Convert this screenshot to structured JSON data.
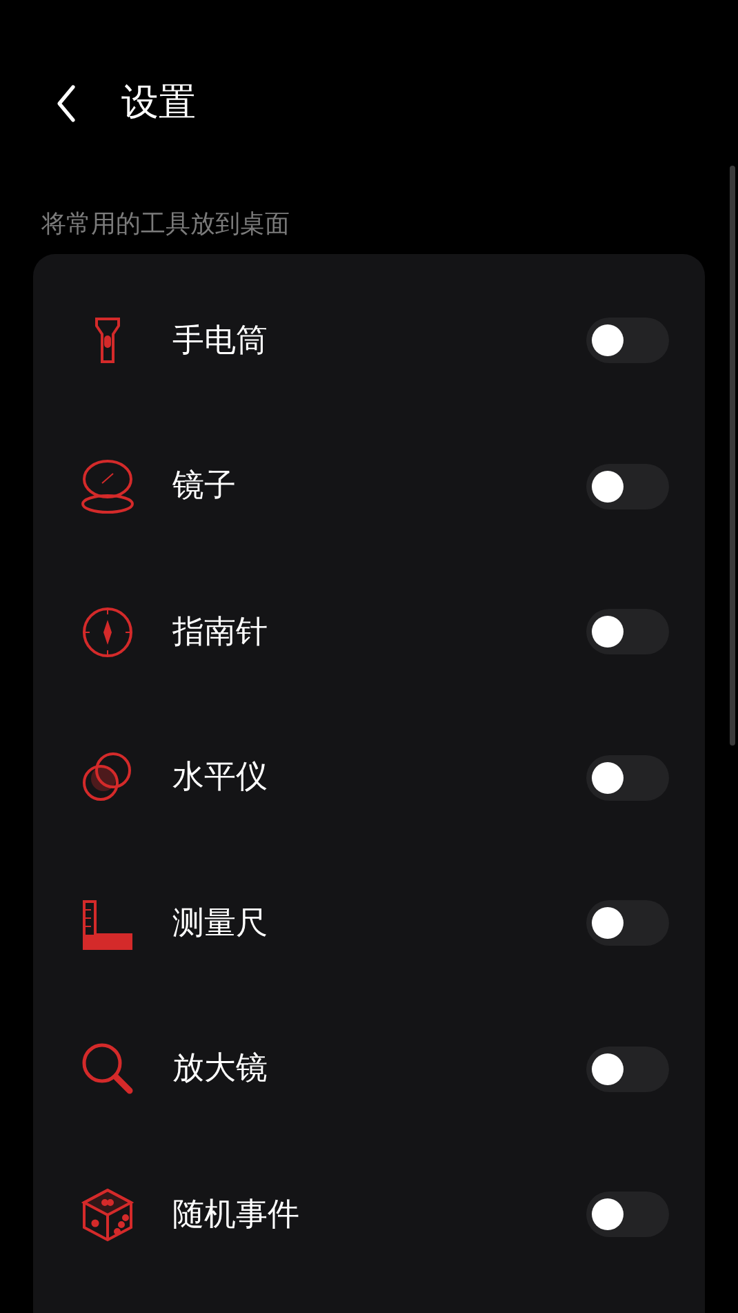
{
  "header": {
    "title": "设置"
  },
  "section": {
    "caption": "将常用的工具放到桌面"
  },
  "tools": [
    {
      "kind": "flashlight",
      "label": "手电筒",
      "on": false
    },
    {
      "kind": "mirror",
      "label": "镜子",
      "on": false
    },
    {
      "kind": "compass",
      "label": "指南针",
      "on": false
    },
    {
      "kind": "level",
      "label": "水平仪",
      "on": false
    },
    {
      "kind": "ruler",
      "label": "测量尺",
      "on": false
    },
    {
      "kind": "magnifier",
      "label": "放大镜",
      "on": false
    },
    {
      "kind": "dice",
      "label": "随机事件",
      "on": false
    }
  ]
}
